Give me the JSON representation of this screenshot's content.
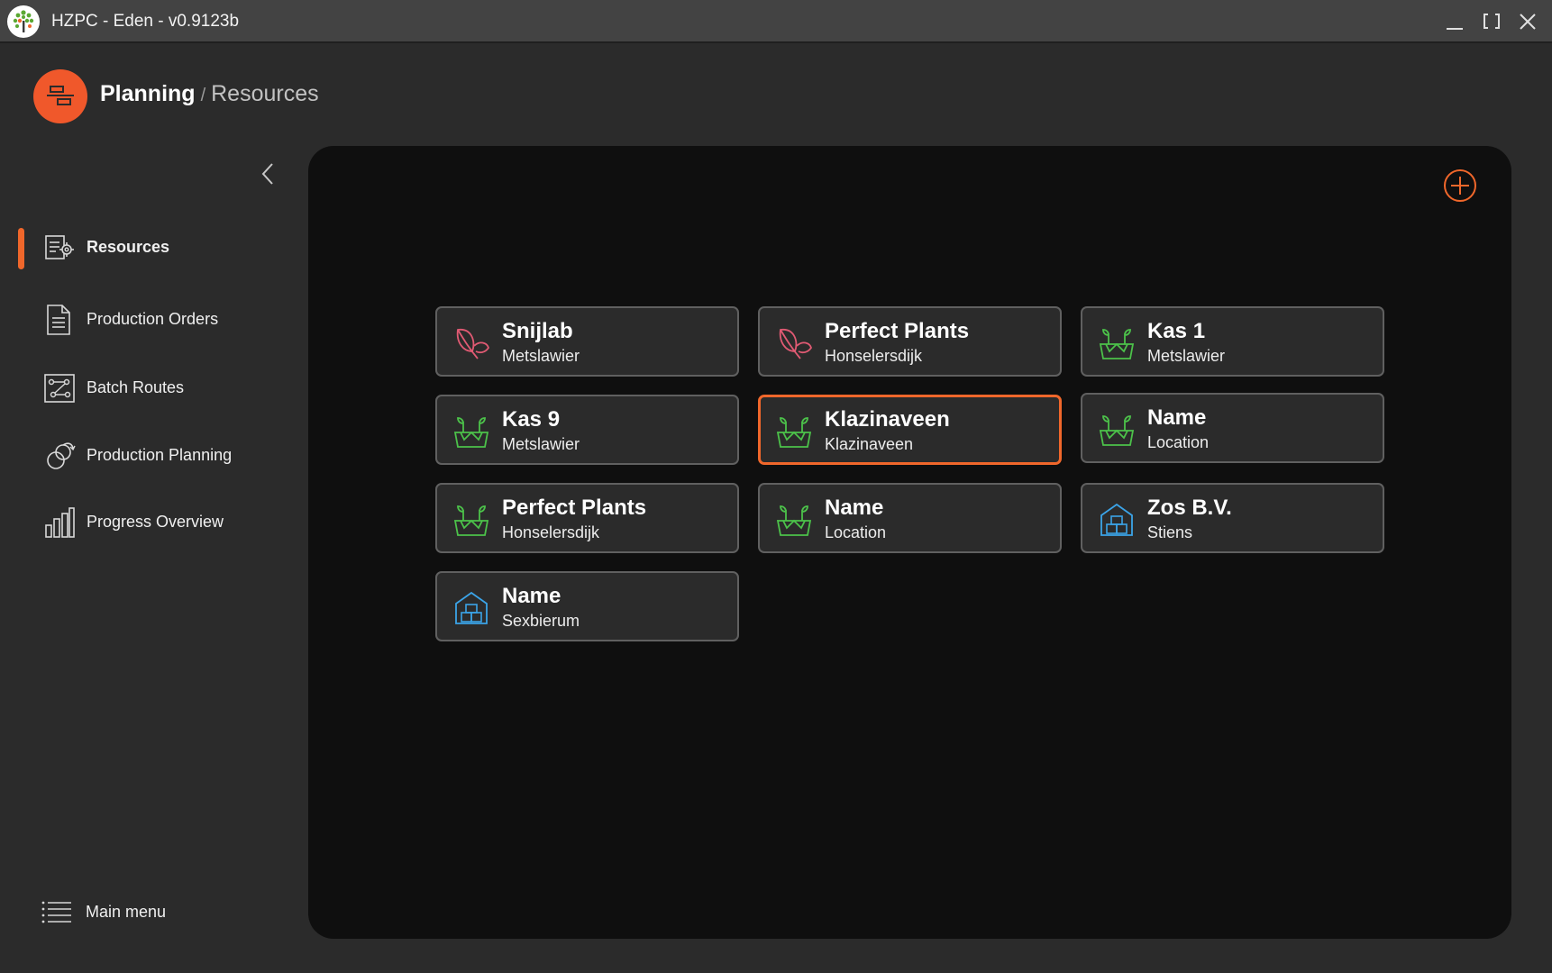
{
  "window": {
    "title": "HZPC - Eden - v0.9123b",
    "logo_icon": "tree-logo-icon",
    "controls": [
      "minimize-icon",
      "maximize-icon",
      "close-icon"
    ]
  },
  "header": {
    "module_icon": "planning-icon",
    "breadcrumb": {
      "primary": "Planning",
      "separator": "/",
      "secondary": "Resources"
    }
  },
  "sidebar": {
    "collapse_icon": "chevron-left-icon",
    "items": [
      {
        "label": "Resources",
        "icon": "resources-icon",
        "active": true
      },
      {
        "label": "Production Orders",
        "icon": "document-icon",
        "active": false
      },
      {
        "label": "Batch Routes",
        "icon": "routes-icon",
        "active": false
      },
      {
        "label": "Production Planning",
        "icon": "planning-cycle-icon",
        "active": false
      },
      {
        "label": "Progress Overview",
        "icon": "bar-chart-icon",
        "active": false
      }
    ],
    "main_menu": {
      "label": "Main menu",
      "icon": "list-menu-icon"
    }
  },
  "main": {
    "add_icon": "plus-circle-icon",
    "resources": [
      {
        "name": "Snijlab",
        "location": "Metslawier",
        "icon": "leaf-icon",
        "selected": false
      },
      {
        "name": "Perfect Plants",
        "location": "Honselersdijk",
        "icon": "leaf-icon",
        "selected": false
      },
      {
        "name": "Kas 1",
        "location": "Metslawier",
        "icon": "seedling-pot-icon",
        "selected": false
      },
      {
        "name": "Kas 9",
        "location": "Metslawier",
        "icon": "seedling-pot-icon",
        "selected": false
      },
      {
        "name": "Klazinaveen",
        "location": "Klazinaveen",
        "icon": "seedling-pot-icon",
        "selected": true
      },
      {
        "name": "Name",
        "location": "Location",
        "icon": "seedling-pot-icon",
        "selected": false
      },
      {
        "name": "Perfect Plants",
        "location": "Honselersdijk",
        "icon": "seedling-pot-icon",
        "selected": false
      },
      {
        "name": "Name",
        "location": "Location",
        "icon": "seedling-pot-icon",
        "selected": false
      },
      {
        "name": "Zos B.V.",
        "location": "Stiens",
        "icon": "warehouse-icon",
        "selected": false
      },
      {
        "name": "Name",
        "location": "Sexbierum",
        "icon": "warehouse-icon",
        "selected": false
      }
    ]
  },
  "colors": {
    "accent": "#f0672b",
    "leaf_icon": "#e05a73",
    "plant_icon": "#4cc24a",
    "warehouse_icon": "#3ba4e8",
    "panel_background": "#0f0f0f",
    "card_background": "#2b2b2b"
  }
}
